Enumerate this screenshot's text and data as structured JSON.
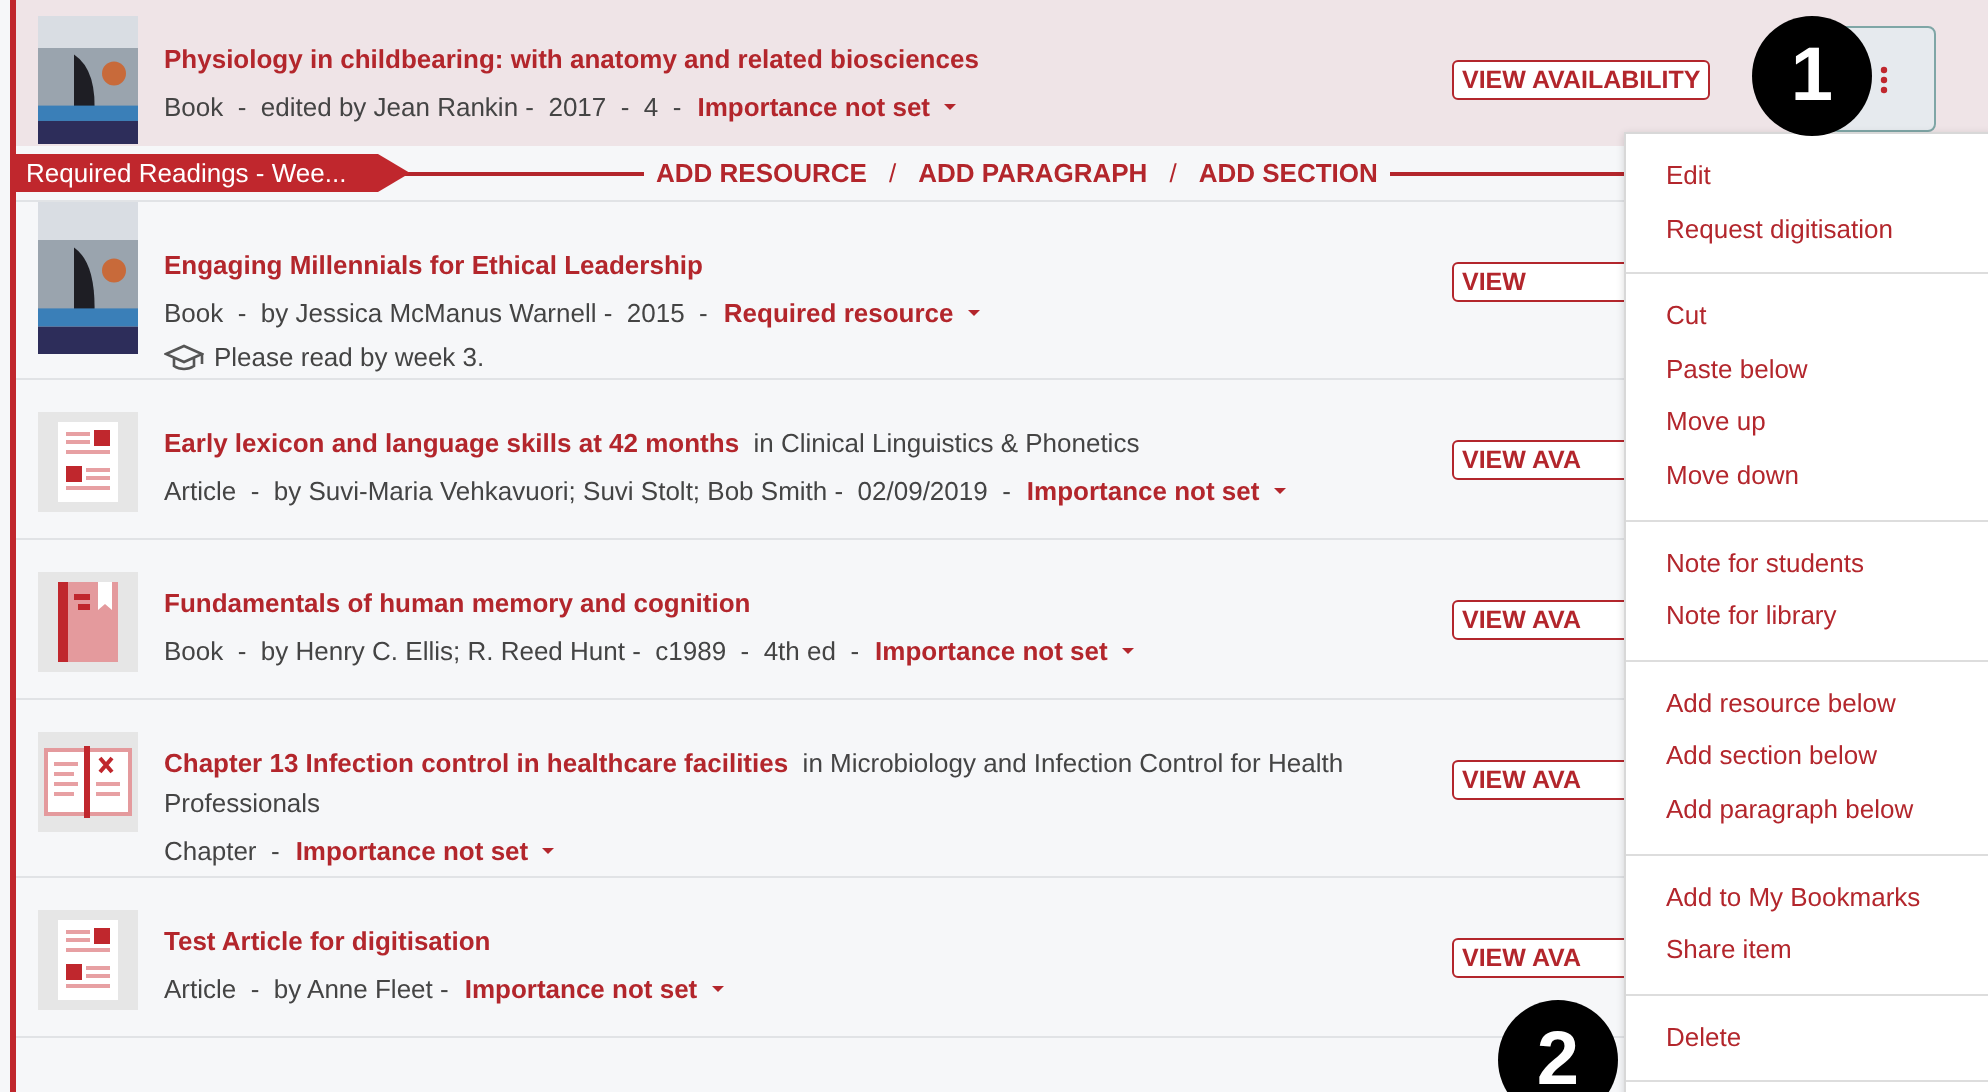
{
  "top_item": {
    "kind": "cover",
    "title": "Physiology in childbearing: with anatomy and related biosciences",
    "meta": "Book  -  edited by Jean Rankin -  2017  -  4  -",
    "importance": "Importance not set",
    "action": "VIEW AVAILABILITY",
    "selected": true
  },
  "section": {
    "title": "Required Readings - Wee...",
    "actions": [
      "ADD RESOURCE",
      "/",
      "ADD PARAGRAPH",
      "/",
      "ADD SECTION"
    ],
    "items": [
      {
        "kind": "cover",
        "title": "Engaging Millennials for Ethical Leadership",
        "meta": "Book  -  by Jessica McManus Warnell -  2015  -",
        "importance": "Required resource",
        "note": "Please read by week 3.",
        "action": "VIEW",
        "selected": false
      },
      {
        "kind": "article",
        "title": "Early lexicon and language skills at 42 months",
        "source": "in Clinical Linguistics & Phonetics",
        "meta": "Article  -  by Suvi-Maria Vehkavuori; Suvi Stolt; Bob Smith -  02/09/2019  -",
        "importance": "Importance not set",
        "action": "VIEW AVA",
        "selected": false
      },
      {
        "kind": "book",
        "title": "Fundamentals of human memory and cognition",
        "meta": "Book  -  by Henry C. Ellis; R. Reed Hunt -  c1989  -  4th ed  -",
        "importance": "Importance not set",
        "action": "VIEW AVA",
        "selected": false
      },
      {
        "kind": "chapter",
        "title": "Chapter 13 Infection control in healthcare facilities",
        "source": "in Microbiology and Infection Control for Health Professionals",
        "meta": "Chapter  -",
        "importance": "Importance not set",
        "action": "VIEW AVA",
        "selected": false
      },
      {
        "kind": "article",
        "title": "Test Article for digitisation",
        "meta": "Article  -  by Anne Fleet -",
        "importance": "Importance not set",
        "action": "VIEW AVA",
        "selected": false
      }
    ]
  },
  "menu": [
    [
      "Edit",
      "Request digitisation"
    ],
    [
      "Cut",
      "Paste below",
      "Move up",
      "Move down"
    ],
    [
      "Note for students",
      "Note for library"
    ],
    [
      "Add resource below",
      "Add section below",
      "Add paragraph below"
    ],
    [
      "Add to My Bookmarks",
      "Share item"
    ],
    [
      "Delete"
    ]
  ],
  "callouts": [
    "1",
    "2"
  ]
}
